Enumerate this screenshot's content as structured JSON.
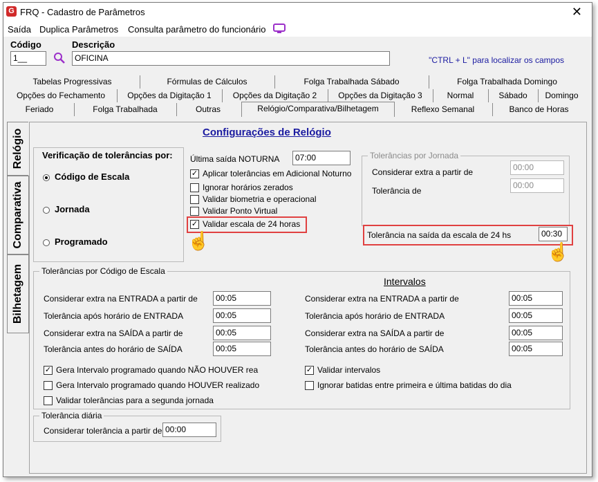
{
  "window": {
    "title": "FRQ - Cadastro de Parâmetros",
    "logo_letter": "G",
    "close_glyph": "✕"
  },
  "menu": {
    "saida": "Saída",
    "duplica": "Duplica Parâmetros",
    "consulta": "Consulta parâmetro do funcionário"
  },
  "header": {
    "codigo_label": "Código",
    "codigo_value": "1__",
    "descricao_label": "Descrição",
    "descricao_value": "OFICINA",
    "hint": "\"CTRL + L\" para localizar os campos"
  },
  "tabs": {
    "row1": [
      "Tabelas Progressivas",
      "Fórmulas de Cálculos",
      "Folga Trabalhada Sábado",
      "Folga Trabalhada Domingo"
    ],
    "row2": [
      "Opções do Fechamento",
      "Opções da Digitação 1",
      "Opções da Digitação 2",
      "Opções da Digitação 3",
      "Normal",
      "Sábado",
      "Domingo"
    ],
    "row3": [
      "Feriado",
      "Folga Trabalhada",
      "Outras",
      "Relógio/Comparativa/Bilhetagem",
      "Reflexo Semanal",
      "Banco de Horas"
    ]
  },
  "side_tabs": [
    "Relógio",
    "Comparativa",
    "Bilhetagem"
  ],
  "section_title": "Configurações de Relógio",
  "verificacao": {
    "title": "Verificação de tolerâncias por:",
    "options": [
      "Código de Escala",
      "Jornada",
      "Programado"
    ],
    "selected": "Código de Escala"
  },
  "ultima_saida": {
    "label": "Última saída NOTURNA",
    "value": "07:00"
  },
  "checks_top": [
    {
      "label": "Aplicar tolerâncias em Adicional Noturno",
      "checked": true
    },
    {
      "label": "Ignorar horários zerados",
      "checked": false
    },
    {
      "label": "Validar biometria e operacional",
      "checked": false
    },
    {
      "label": "Validar Ponto Virtual",
      "checked": false
    },
    {
      "label": "Validar escala de 24 horas",
      "checked": true
    }
  ],
  "jornada": {
    "title": "Tolerâncias por Jornada",
    "extra_label": "Considerar extra a partir de",
    "extra_value": "00:00",
    "tol_label": "Tolerância de",
    "tol_value": "00:00"
  },
  "escala24": {
    "label": "Tolerância na saída da escala de 24 hs",
    "value": "00:30"
  },
  "codigo_escala": {
    "title": "Tolerâncias por Código de Escala",
    "rows": [
      {
        "label": "Considerar extra na ENTRADA a partir de",
        "value": "00:05"
      },
      {
        "label": "Tolerância após horário de ENTRADA",
        "value": "00:05"
      },
      {
        "label": "Considerar extra na SAÍDA a partir de",
        "value": "00:05"
      },
      {
        "label": "Tolerância antes do horário de SAÍDA",
        "value": "00:05"
      }
    ],
    "checks": [
      {
        "label": "Gera Intervalo programado quando NÃO HOUVER rea",
        "checked": true
      },
      {
        "label": "Gera Intervalo programado quando HOUVER realizado",
        "checked": false
      },
      {
        "label": "Validar tolerâncias para a segunda jornada",
        "checked": false
      }
    ]
  },
  "intervalos": {
    "title": "Intervalos",
    "rows": [
      {
        "label": "Considerar extra na ENTRADA a partir de",
        "value": "00:05"
      },
      {
        "label": "Tolerância após horário de ENTRADA",
        "value": "00:05"
      },
      {
        "label": "Considerar extra na SAÍDA a partir de",
        "value": "00:05"
      },
      {
        "label": "Tolerância antes do horário de SAÍDA",
        "value": "00:05"
      }
    ],
    "checks": [
      {
        "label": "Validar intervalos",
        "checked": true
      },
      {
        "label": "Ignorar batidas entre primeira e última batidas do dia",
        "checked": false
      }
    ]
  },
  "diaria": {
    "title": "Tolerância diária",
    "label": "Considerar tolerância a partir de",
    "value": "00:00"
  },
  "colors": {
    "accent_link": "#1a1aa0",
    "highlight": "#e04040",
    "purple_icon": "#9b2fc9"
  }
}
